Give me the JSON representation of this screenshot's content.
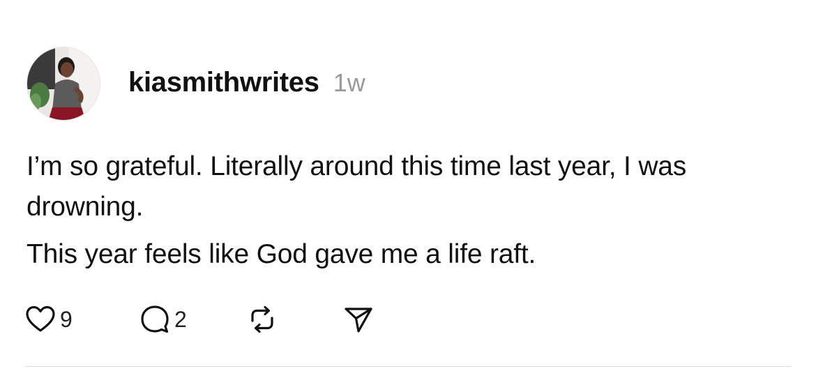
{
  "post": {
    "username": "kiasmithwrites",
    "timestamp": "1w",
    "text": {
      "paragraph_1": "I’m so grateful. Literally around this time last year, I was drowning.",
      "paragraph_2": "This year feels like God gave me a life raft."
    },
    "actions": {
      "like_count": "9",
      "reply_count": "2"
    },
    "icons": {
      "like": "heart-icon",
      "reply": "comment-bubble-icon",
      "repost": "repost-icon",
      "share": "send-icon"
    }
  }
}
